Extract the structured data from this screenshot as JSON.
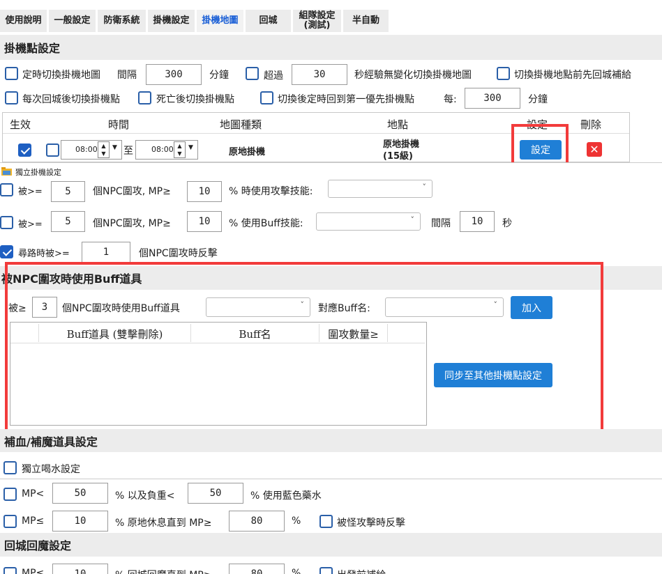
{
  "tabs": [
    {
      "label": "使用說明"
    },
    {
      "label": "一般設定"
    },
    {
      "label": "防衛系統"
    },
    {
      "label": "掛機設定"
    },
    {
      "label": "掛機地圖"
    },
    {
      "label": "回城"
    },
    {
      "label": "組隊設定\n(測試)"
    },
    {
      "label": "半自動"
    }
  ],
  "spot": {
    "title": "掛機點設定",
    "row1": {
      "timed_switch": "定時切換掛機地圖",
      "interval": "間隔",
      "interval_val": "300",
      "minutes": "分鐘",
      "over": "超過",
      "over_val": "30",
      "no_exp": "秒經驗無變化切換掛機地圖",
      "return_first": "切換掛機地點前先回城補給"
    },
    "row2": {
      "each_return": "每次回城後切換掛機點",
      "after_death": "死亡後切換掛機點",
      "back_first": "切換後定時回到第一優先掛機點",
      "every": "每:",
      "every_val": "300",
      "minutes": "分鐘"
    },
    "table": {
      "headers": {
        "active": "生效",
        "time": "時間",
        "map_type": "地圖種類",
        "location": "地點",
        "settings": "設定",
        "delete": "刪除"
      },
      "row": {
        "time_from": "08:00",
        "to": "至",
        "time_to": "08:00",
        "map_type": "原地掛機",
        "location": "原地掛機\n(15級)",
        "settings_btn": "設定"
      }
    }
  },
  "dialog": {
    "title": "獨立掛機設定",
    "r1": {
      "prefix": "被>=",
      "count": "5",
      "npc": "個NPC圍攻, MP≥",
      "mp": "10",
      "use": "% 時使用攻擊技能:"
    },
    "r2": {
      "prefix": "被>=",
      "count": "5",
      "npc": "個NPC圍攻, MP≥",
      "mp": "10",
      "use": "% 使用Buff技能:",
      "interval": "間隔",
      "interval_val": "10",
      "sec": "秒"
    },
    "r3": {
      "label": "尋路時被>=",
      "count": "1",
      "suffix": "個NPC圍攻時反擊"
    }
  },
  "buff_item": {
    "title": "被NPC圍攻時使用Buff道具",
    "prefix": "被≥",
    "count": "3",
    "npc_label": "個NPC圍攻時使用Buff道具",
    "buff_name_label": "對應Buff名:",
    "add_btn": "加入",
    "table_headers": {
      "item": "Buff道具 (雙擊刪除)",
      "name": "Buff名",
      "count": "圍攻數量≥"
    },
    "sync_btn": "同步至其他掛機點設定"
  },
  "potion": {
    "title": "補血/補魔道具設定",
    "independent": "獨立喝水設定",
    "r1": {
      "mp": "MP<",
      "mp_val": "50",
      "weight": "% 以及負重<",
      "weight_val": "50",
      "blue": "% 使用藍色藥水"
    },
    "r2": {
      "mp": "MP≤",
      "mp_val": "10",
      "rest": "% 原地休息直到 MP≥",
      "rest_val": "80",
      "pct": "%",
      "counter": "被怪攻擊時反擊"
    }
  },
  "return_mp": {
    "title": "回城回魔設定",
    "r1": {
      "mp": "MP≤",
      "mp_val": "10",
      "text": "% 回城回魔直到 MP≥",
      "val": "80",
      "pct": "%",
      "supply": "出發前補給"
    }
  }
}
